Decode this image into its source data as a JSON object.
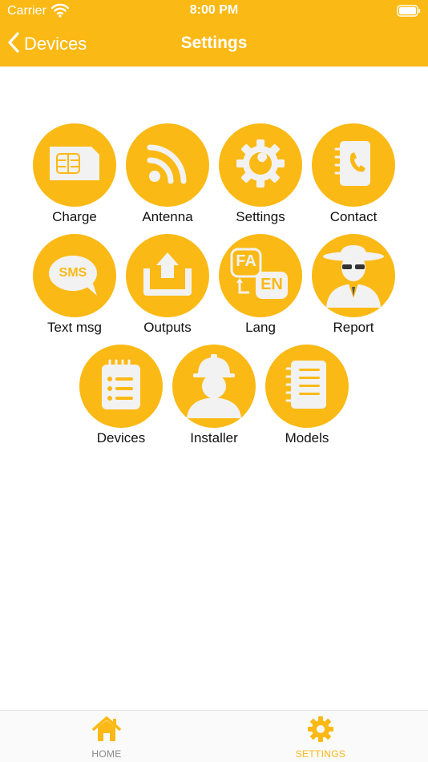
{
  "status_bar": {
    "carrier": "Carrier",
    "time": "8:00 PM"
  },
  "nav": {
    "back_label": "Devices",
    "title": "Settings"
  },
  "grid": {
    "items": [
      {
        "label": "Charge",
        "icon": "sim-card-icon"
      },
      {
        "label": "Antenna",
        "icon": "antenna-signal-icon"
      },
      {
        "label": "Settings",
        "icon": "gear-wrench-icon"
      },
      {
        "label": "Contact",
        "icon": "phonebook-icon"
      },
      {
        "label": "Text msg",
        "icon": "sms-bubble-icon",
        "badge": "SMS"
      },
      {
        "label": "Outputs",
        "icon": "upload-tray-icon"
      },
      {
        "label": "Lang",
        "icon": "language-fa-en-icon",
        "lang_a": "FA",
        "lang_b": "EN"
      },
      {
        "label": "Report",
        "icon": "agent-icon"
      },
      {
        "label": "Devices",
        "icon": "notepad-list-icon"
      },
      {
        "label": "Installer",
        "icon": "worker-helmet-icon"
      },
      {
        "label": "Models",
        "icon": "notebook-lines-icon"
      }
    ]
  },
  "tabbar": {
    "home_label": "HOME",
    "settings_label": "SETTINGS"
  },
  "colors": {
    "accent": "#FBB915",
    "icon_fill": "#F2F2F2",
    "inactive_tab": "#8a8a8a"
  }
}
